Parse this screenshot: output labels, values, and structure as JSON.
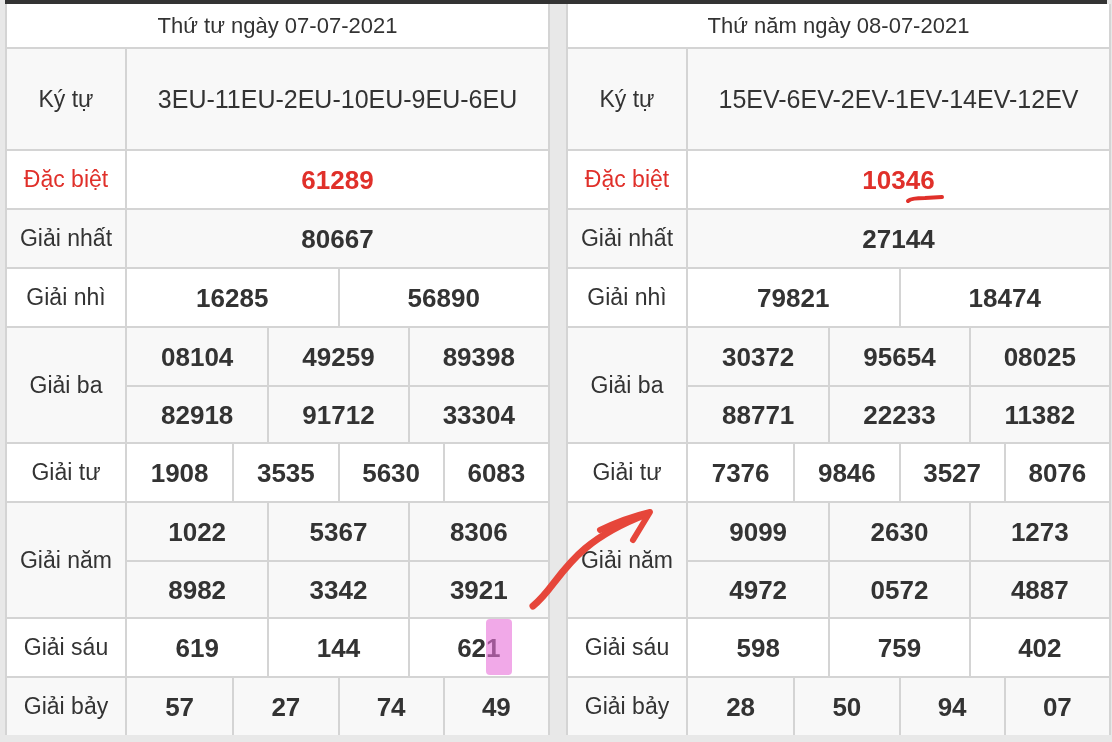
{
  "tables": [
    {
      "title": "Thứ tư ngày 07-07-2021",
      "rows": [
        {
          "label": "Ký tự",
          "kind": "code",
          "lines": [
            [
              "3EU-11EU-2EU-10EU-9EU-6EU"
            ]
          ]
        },
        {
          "label": "Đặc biệt",
          "kind": "special",
          "lines": [
            [
              "61289"
            ]
          ]
        },
        {
          "label": "Giải nhất",
          "kind": "prize",
          "lines": [
            [
              "80667"
            ]
          ]
        },
        {
          "label": "Giải nhì",
          "kind": "prize",
          "lines": [
            [
              "16285",
              "56890"
            ]
          ]
        },
        {
          "label": "Giải ba",
          "kind": "prize",
          "lines": [
            [
              "08104",
              "49259",
              "89398"
            ],
            [
              "82918",
              "91712",
              "33304"
            ]
          ]
        },
        {
          "label": "Giải tư",
          "kind": "prize",
          "lines": [
            [
              "1908",
              "3535",
              "5630",
              "6083"
            ]
          ]
        },
        {
          "label": "Giải năm",
          "kind": "prize",
          "lines": [
            [
              "1022",
              "5367",
              "8306"
            ],
            [
              "8982",
              "3342",
              "3921"
            ]
          ]
        },
        {
          "label": "Giải sáu",
          "kind": "prize",
          "lines": [
            [
              "619",
              "144",
              "621"
            ]
          ]
        },
        {
          "label": "Giải bảy",
          "kind": "prize",
          "lines": [
            [
              "57",
              "27",
              "74",
              "49"
            ]
          ]
        }
      ]
    },
    {
      "title": "Thứ năm ngày 08-07-2021",
      "rows": [
        {
          "label": "Ký tự",
          "kind": "code",
          "lines": [
            [
              "15EV-6EV-2EV-1EV-14EV-12EV"
            ]
          ]
        },
        {
          "label": "Đặc biệt",
          "kind": "special",
          "lines": [
            [
              "10346"
            ]
          ]
        },
        {
          "label": "Giải nhất",
          "kind": "prize",
          "lines": [
            [
              "27144"
            ]
          ]
        },
        {
          "label": "Giải nhì",
          "kind": "prize",
          "lines": [
            [
              "79821",
              "18474"
            ]
          ]
        },
        {
          "label": "Giải ba",
          "kind": "prize",
          "lines": [
            [
              "30372",
              "95654",
              "08025"
            ],
            [
              "88771",
              "22233",
              "11382"
            ]
          ]
        },
        {
          "label": "Giải tư",
          "kind": "prize",
          "lines": [
            [
              "7376",
              "9846",
              "3527",
              "8076"
            ]
          ]
        },
        {
          "label": "Giải năm",
          "kind": "prize",
          "lines": [
            [
              "9099",
              "2630",
              "1273"
            ],
            [
              "4972",
              "0572",
              "4887"
            ]
          ]
        },
        {
          "label": "Giải sáu",
          "kind": "prize",
          "lines": [
            [
              "598",
              "759",
              "402"
            ]
          ]
        },
        {
          "label": "Giải bảy",
          "kind": "prize",
          "lines": [
            [
              "28",
              "50",
              "94",
              "07"
            ]
          ]
        }
      ]
    }
  ]
}
